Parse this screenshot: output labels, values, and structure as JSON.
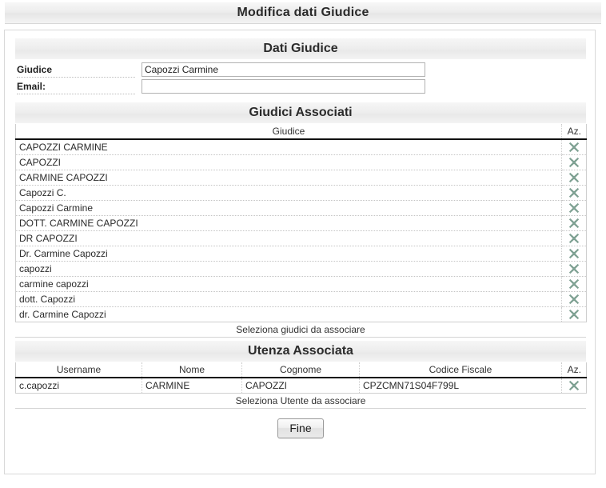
{
  "window": {
    "title": "Modifica dati Giudice"
  },
  "dati_giudice": {
    "heading": "Dati Giudice",
    "fields": [
      {
        "label": "Giudice",
        "value": "Capozzi Carmine",
        "placeholder": ""
      },
      {
        "label": "Email:",
        "value": "",
        "placeholder": ""
      }
    ]
  },
  "giudici_associati": {
    "heading": "Giudici Associati",
    "columns": [
      "Giudice",
      "Az."
    ],
    "rows": [
      "CAPOZZI CARMINE",
      "CAPOZZI",
      "CARMINE CAPOZZI",
      "Capozzi C.",
      "Capozzi Carmine",
      "DOTT. CARMINE CAPOZZI",
      "DR CAPOZZI",
      "Dr. Carmine Capozzi",
      "capozzi",
      "carmine capozzi",
      "dott. Capozzi",
      "dr. Carmine Capozzi"
    ],
    "footer": "Seleziona giudici da associare",
    "delete_icon": "delete-x-icon"
  },
  "utenza_associata": {
    "heading": "Utenza Associata",
    "columns": [
      "Username",
      "Nome",
      "Cognome",
      "Codice Fiscale",
      "Az."
    ],
    "rows": [
      {
        "username": "c.capozzi",
        "nome": "CARMINE",
        "cognome": "CAPOZZI",
        "codice_fiscale": "CPZCMN71S04F799L"
      }
    ],
    "footer": "Seleziona Utente da associare",
    "delete_icon": "delete-x-icon"
  },
  "actions": {
    "fine_label": "Fine"
  },
  "colors": {
    "delete_icon": "#7fa394",
    "header_bg": "#ededed",
    "text": "#222222"
  }
}
